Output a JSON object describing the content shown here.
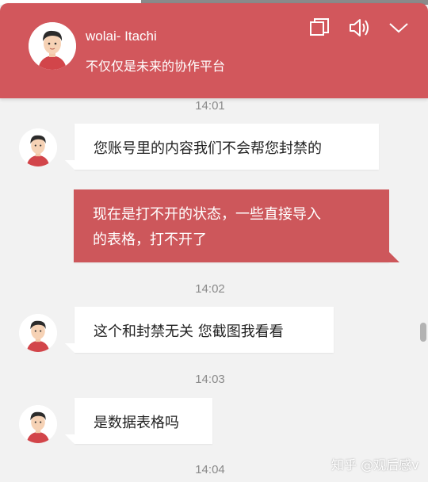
{
  "header": {
    "name": "wolai- Itachi",
    "subtitle": "不仅仅是未来的协作平台",
    "icons": [
      "restore-window-icon",
      "speaker-icon",
      "chevron-down-icon"
    ]
  },
  "colors": {
    "accent": "#d2575c",
    "bubble_self": "#cd575b",
    "background": "#f2f2f2"
  },
  "messages": [
    {
      "time": "14:01",
      "side": "left",
      "text": "您账号里的内容我们不会帮您封禁的"
    },
    {
      "side": "right",
      "lines": [
        "现在是打不开的状态，一些直接导入",
        "的表格，打不开了"
      ]
    },
    {
      "time": "14:02",
      "side": "left",
      "text": "这个和封禁无关 您截图我看看"
    },
    {
      "time": "14:03",
      "side": "left",
      "text": "是数据表格吗"
    },
    {
      "time": "14:04"
    }
  ],
  "watermark": "知乎 @观后感v"
}
